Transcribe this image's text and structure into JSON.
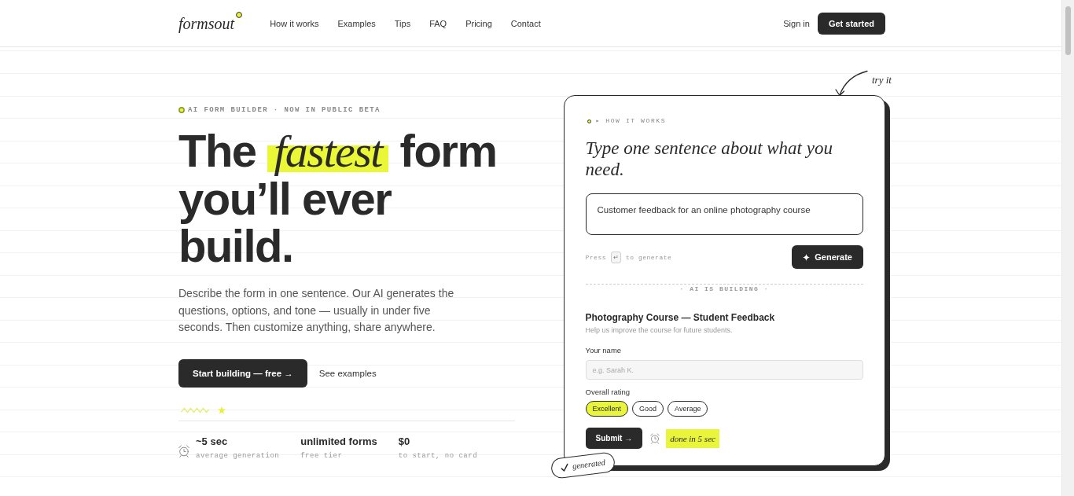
{
  "header": {
    "logo": "formsout",
    "nav": [
      "How it works",
      "Examples",
      "Tips",
      "FAQ",
      "Pricing",
      "Contact"
    ],
    "sign_in": "Sign in",
    "cta": "Get started"
  },
  "hero": {
    "eyebrow": "AI FORM BUILDER · NOW IN PUBLIC BETA",
    "headline": "The *fastest* form you’ll ever build.",
    "description": "Describe the form in one sentence. Our AI generates the questions, options, and tone — usually in under five seconds. Then customize anything, share anywhere.",
    "primary_button": "Start building — free →",
    "secondary_link": "See examples",
    "stats": [
      {
        "kind": "with-icon",
        "value": "~5 sec",
        "caption": "average generation"
      },
      {
        "kind": "plain",
        "value": "unlimited forms",
        "caption": "free tier"
      },
      {
        "kind": "plain",
        "value": "$0",
        "caption": "to start, no card"
      }
    ]
  },
  "demo_card": {
    "annotation": "try it",
    "eyebrow": "▸ HOW IT WORKS",
    "title": "Type one sentence about what you need.",
    "prompt": {
      "value": "Customer feedback for an online photography course"
    },
    "hint": {
      "before": "Press",
      "key": "↵",
      "after": "to generate"
    },
    "generate_button": "Generate",
    "divider_label": "· AI IS BUILDING ·",
    "form": {
      "title": "Photography Course — Student Feedback",
      "subtitle": "Help us improve the course for future students.",
      "fields": [
        {
          "kind": "text",
          "label": "Your name",
          "placeholder": "e.g. Sarah K."
        },
        {
          "kind": "choice",
          "label": "Overall rating",
          "options": [
            {
              "label": "Excellent",
              "selected": true
            },
            {
              "label": "Good",
              "selected": false
            },
            {
              "label": "Average",
              "selected": false
            }
          ]
        }
      ],
      "submit_button": "Submit →",
      "timing": "done in 5 sec"
    },
    "sticker": "generated"
  }
}
